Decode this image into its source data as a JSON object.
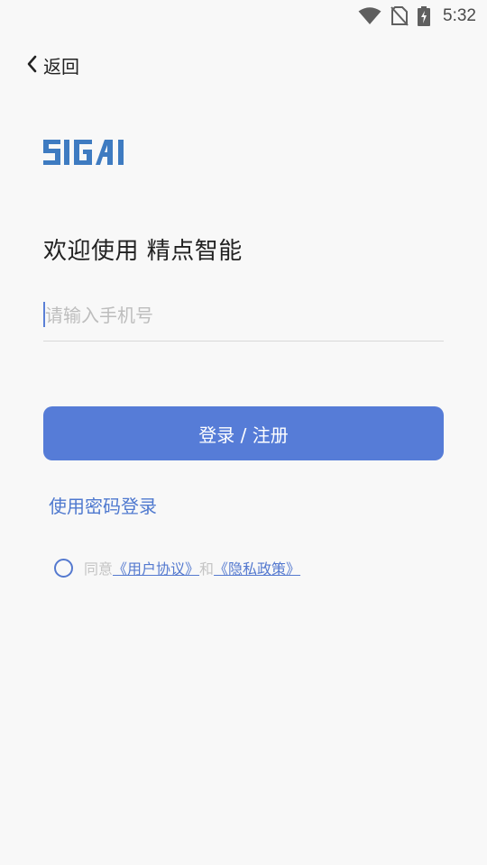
{
  "status_bar": {
    "time": "5:32",
    "icons": [
      "wifi-icon",
      "no-sim-icon",
      "battery-charging-icon"
    ]
  },
  "nav": {
    "back_label": "返回",
    "back_icon": "chevron-left-icon"
  },
  "brand": {
    "logo_text": "SIGAI",
    "logo_color": "#3e7bc1"
  },
  "welcome_text": "欢迎使用 精点智能",
  "phone": {
    "placeholder": "请输入手机号",
    "value": ""
  },
  "login_button_label": "登录 / 注册",
  "password_login_label": "使用密码登录",
  "agreement": {
    "prefix": "同意",
    "user_agreement": "《用户协议》",
    "conjunction": "和",
    "privacy_policy": "《隐私政策》",
    "checked": false
  },
  "colors": {
    "accent": "#567cd7",
    "link": "#4f79cf",
    "background": "#f8f8f8"
  }
}
